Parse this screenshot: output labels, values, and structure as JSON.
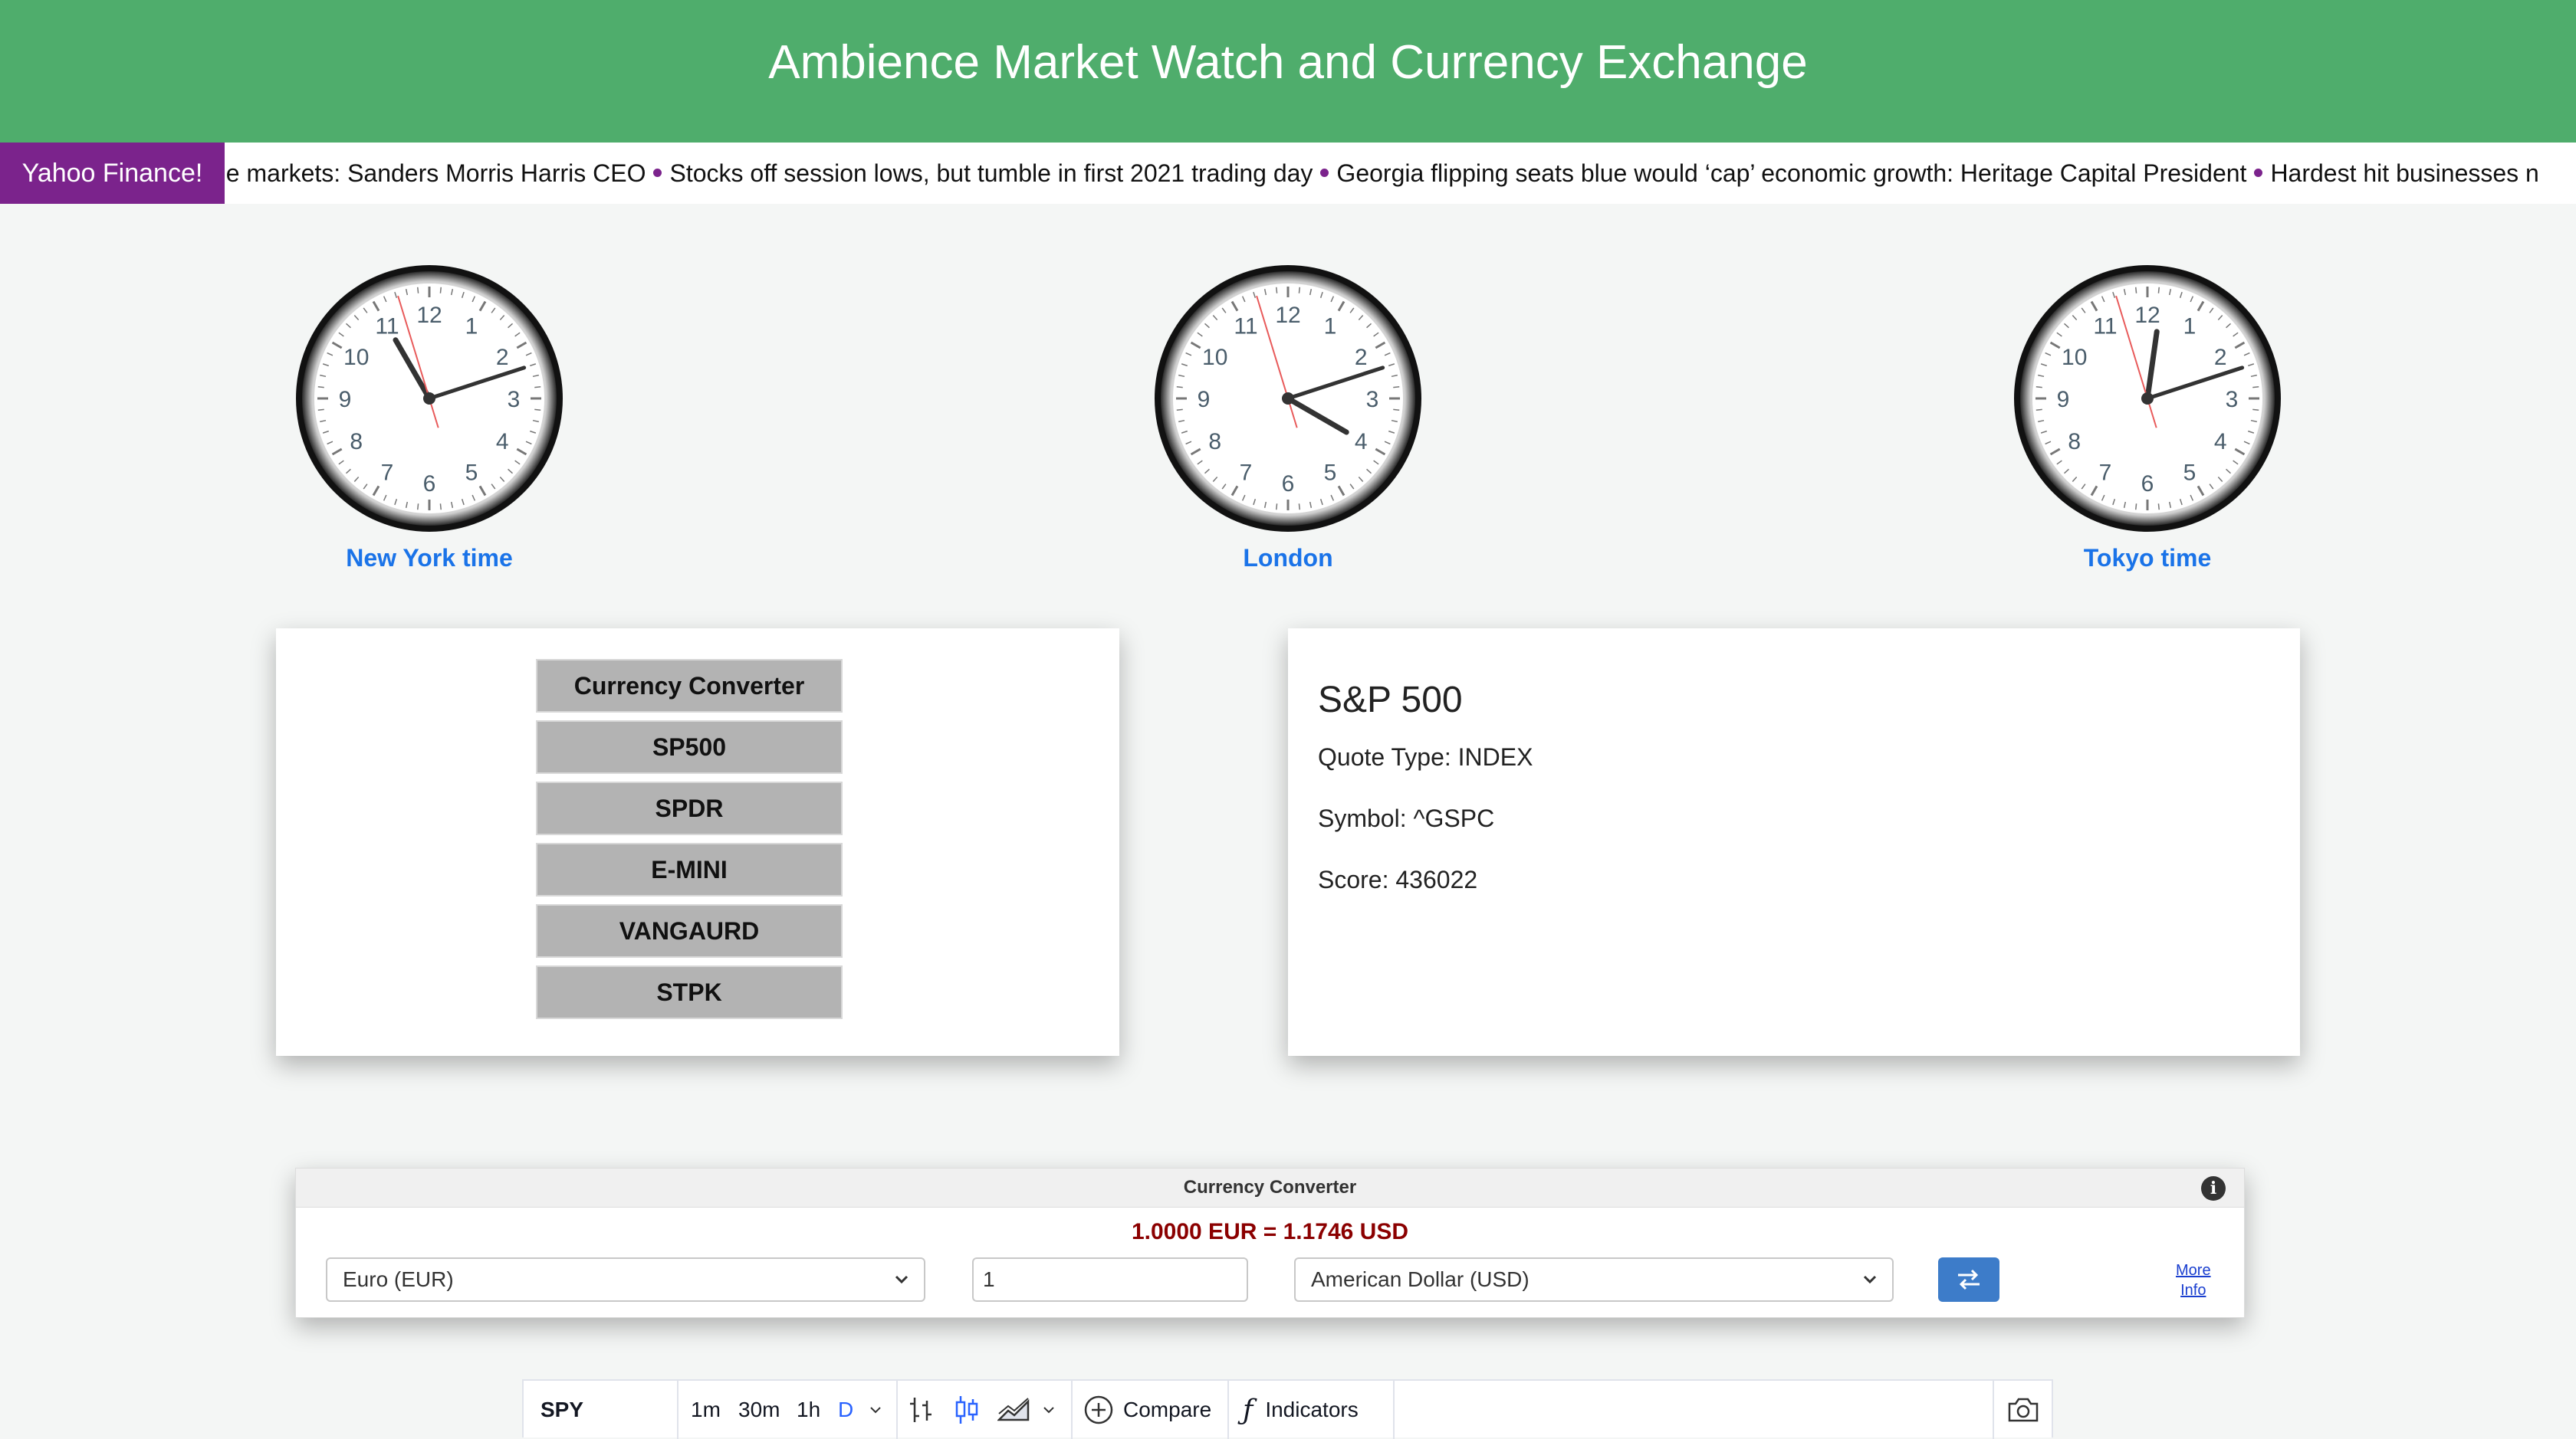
{
  "header": {
    "title": "Ambience Market Watch and Currency Exchange"
  },
  "ticker": {
    "label": "Yahoo Finance!",
    "items": [
      "he markets: Sanders Morris Harris CEO",
      "Stocks off session lows, but tumble in first 2021 trading day",
      "Georgia flipping seats blue would ‘cap’ economic growth: Heritage Capital President",
      "Hardest hit businesses n"
    ]
  },
  "clocks": [
    {
      "label": "New York time",
      "hours": [
        "12",
        "1",
        "2",
        "3",
        "4",
        "5",
        "6",
        "7",
        "8",
        "9",
        "10",
        "11"
      ]
    },
    {
      "label": "London"
    },
    {
      "label": "Tokyo time"
    }
  ],
  "menu": {
    "buttons": [
      "Currency Converter",
      "SP500",
      "SPDR",
      "E-MINI",
      "VANGAURD",
      "STPK"
    ]
  },
  "quote": {
    "title": "S&P 500",
    "quote_type": "Quote Type: INDEX",
    "symbol": "Symbol: ^GSPC",
    "score": "Score: 436022"
  },
  "converter": {
    "title": "Currency Converter",
    "info_icon": "i",
    "result": "1.0000 EUR = 1.1746 USD",
    "from_currency": "Euro (EUR)",
    "amount": "1",
    "to_currency": "American Dollar (USD)",
    "more_info_line1": "More",
    "more_info_line2": "Info"
  },
  "chart_toolbar": {
    "symbol": "SPY",
    "intervals": [
      "1m",
      "30m",
      "1h",
      "D"
    ],
    "active_interval": "D",
    "compare_label": "Compare",
    "indicators_label": "Indicators"
  },
  "colors": {
    "header_bg": "#4fad6c",
    "ticker_label_bg": "#7b238c",
    "clock_label": "#1a73e8",
    "converter_result": "#8b0000",
    "swap_button": "#3d7cc9"
  }
}
